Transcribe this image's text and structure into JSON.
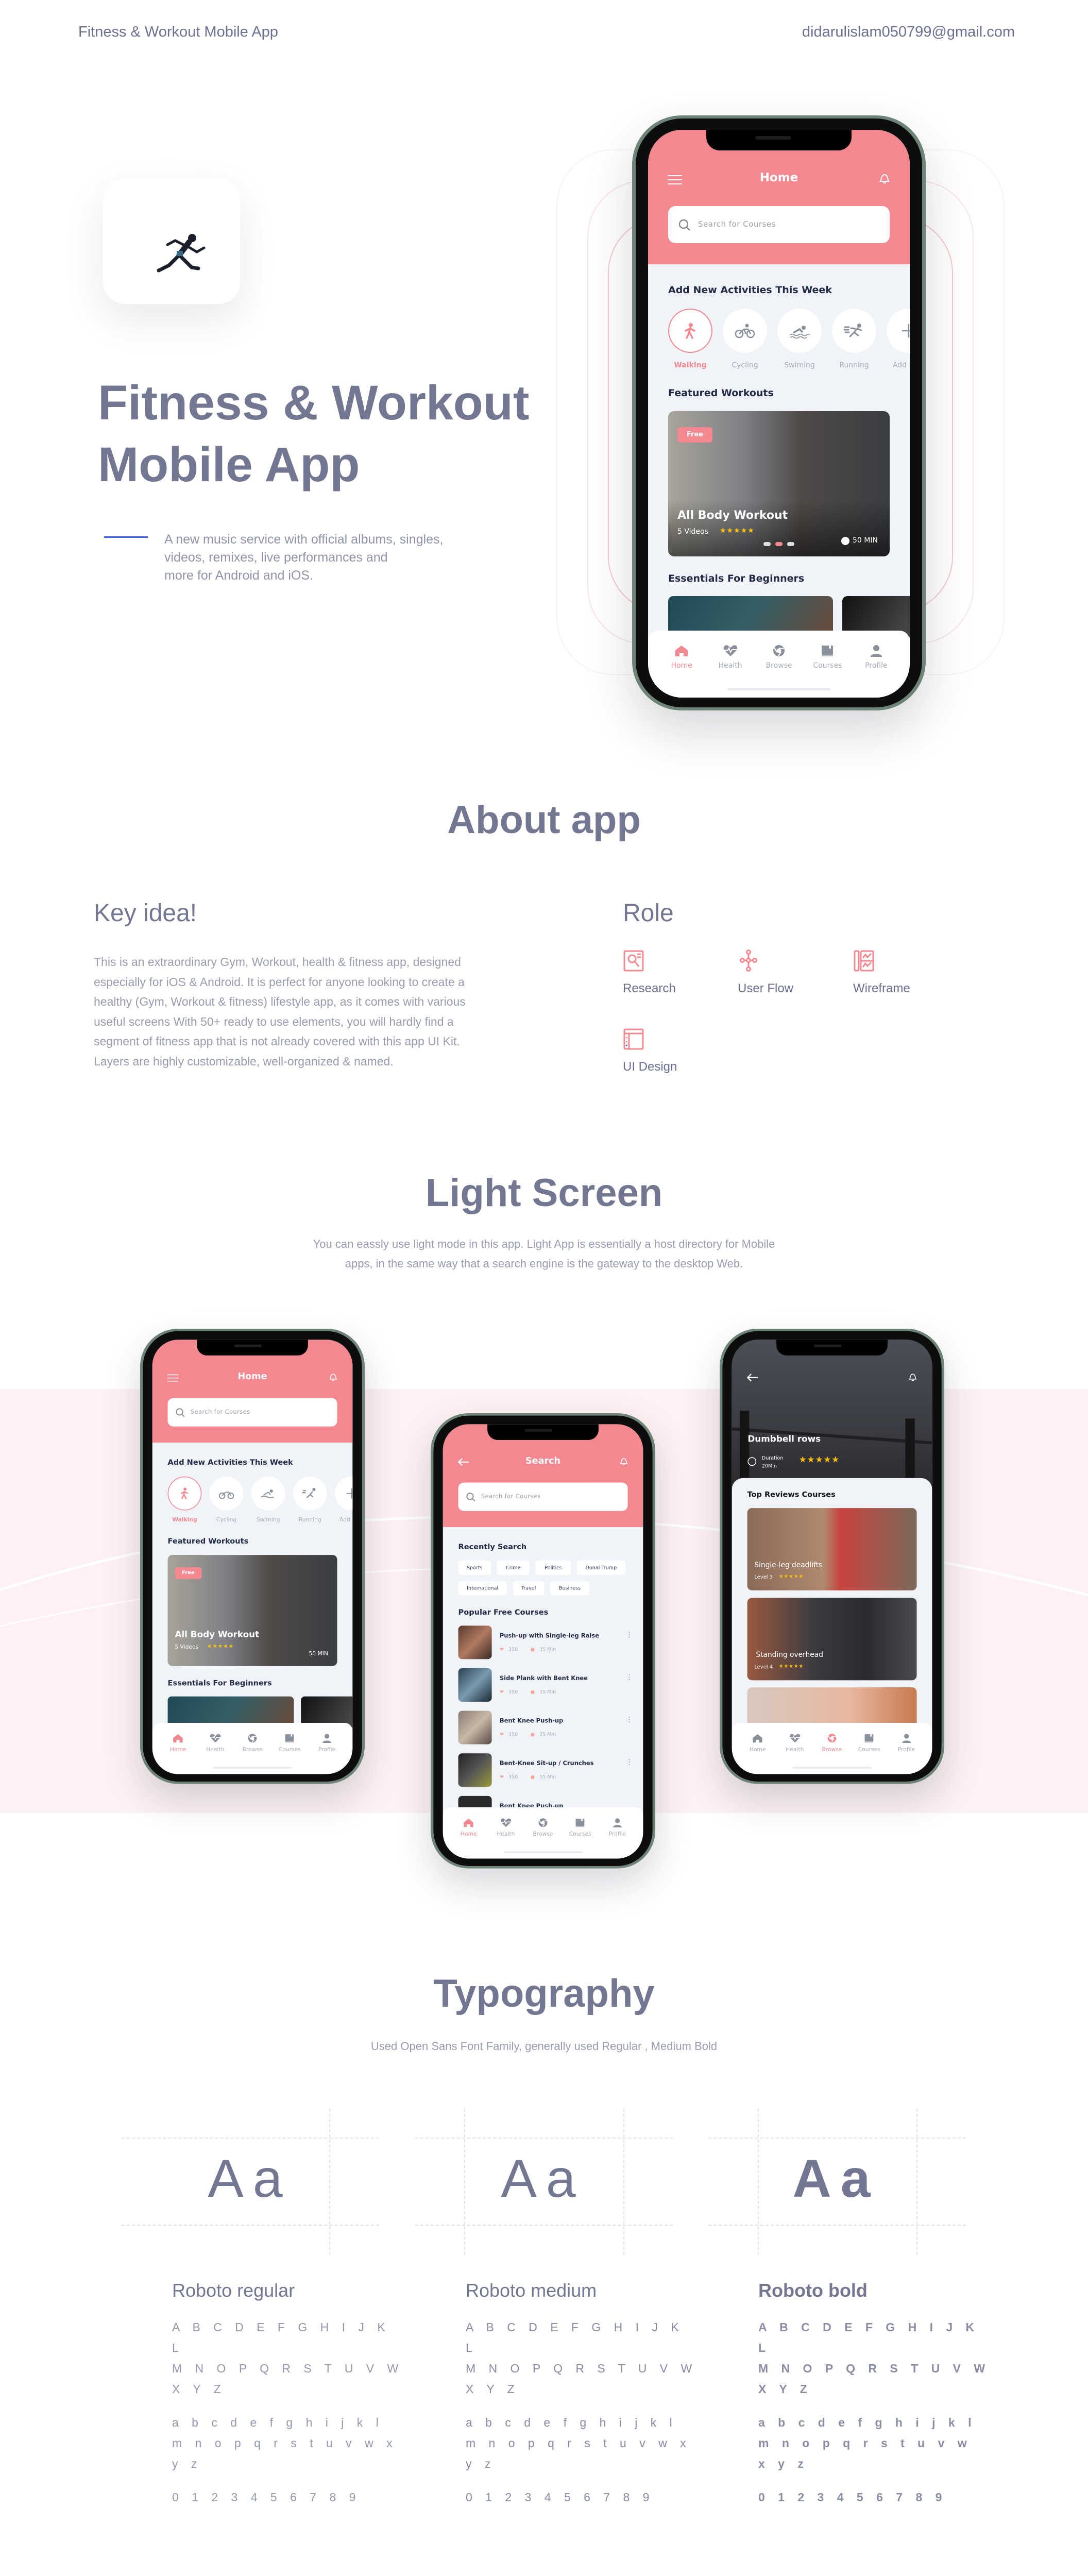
{
  "header": {
    "title": "Fitness & Workout Mobile App",
    "email": "didarulislam050799@gmail.com"
  },
  "hero": {
    "title_lines": [
      "Fitness & Workout",
      "Mobile App"
    ],
    "description_lines": [
      "A new music service with official albums, singles,",
      "videos, remixes, live performances and",
      "more for Android and iOS."
    ]
  },
  "tabbar": [
    "Home",
    "Health",
    "Browse",
    "Courses",
    "Profile"
  ],
  "colors": {
    "accent": "#f48891",
    "title": "#737791",
    "screen_bg": "#f0f3f8",
    "band": "#fdf1f3",
    "star": "#ffc107",
    "underline": "#3a5df0"
  },
  "home_screen": {
    "title": "Home",
    "search_placeholder": "Search for Courses",
    "activities_title": "Add New Activities This Week",
    "activities": [
      {
        "label": "Walking",
        "icon": "walking-icon",
        "active": true
      },
      {
        "label": "Cycling",
        "icon": "cycling-icon"
      },
      {
        "label": "Swiming",
        "icon": "swimming-icon"
      },
      {
        "label": "Running",
        "icon": "running-icon"
      },
      {
        "label": "Add New",
        "icon": "plus-icon"
      }
    ],
    "featured_title": "Featured Workouts",
    "featured": {
      "badge": "Free",
      "title": "All Body Workout",
      "videos": "5 Videos",
      "rating": 5,
      "duration": "50 MIN",
      "stars": "★★★★★"
    },
    "essentials_title": "Essentials For Beginners",
    "active_tab": "Home"
  },
  "search_screen": {
    "title": "Search",
    "search_placeholder": "Search for Courses",
    "recent_title": "Recently Search",
    "chips": [
      "Sports",
      "Crime",
      "Politics",
      "Donal Trump",
      "International",
      "Travel",
      "Business"
    ],
    "popular_title": "Popular Free Courses",
    "courses": [
      {
        "name": "Push-up with Single-leg Raise",
        "likes": "350",
        "duration": "35 Min"
      },
      {
        "name": "Side Plank with Bent Knee",
        "likes": "350",
        "duration": "35 Min"
      },
      {
        "name": "Bent Knee Push-up",
        "likes": "350",
        "duration": "35 Min"
      },
      {
        "name": "Bent-Knee Sit-up / Crunches",
        "likes": "350",
        "duration": "35 Min"
      },
      {
        "name": "Bent Knee Push-up",
        "likes": "",
        "duration": ""
      }
    ],
    "active_tab": "Home"
  },
  "detail_screen": {
    "title": "Dumbbell rows",
    "duration_label": "Duration",
    "duration_value": "20Min",
    "rating": 5,
    "stars": "★★★★★",
    "section_title": "Top Reviews Courses",
    "cards": [
      {
        "title": "Single-leg deadlifts",
        "level": "Level 3",
        "rating": 5
      },
      {
        "title": "Standing overhead",
        "level": "Level 4",
        "rating": 5
      }
    ],
    "active_tab": "Browse"
  },
  "about": {
    "title": "About app",
    "key_idea_title": "Key idea!",
    "key_idea_lines": [
      "This is an extraordinary Gym, Workout, health & fitness app, designed",
      "especially for iOS & Android. It is perfect for anyone looking to create a",
      "healthy (Gym, Workout & fitness) lifestyle app, as it comes with various",
      "useful screens With 50+ ready to use elements, you will hardly find a",
      "segment of fitness app that is not already covered with this app UI Kit.",
      "Layers are highly customizable, well-organized & named."
    ],
    "role_title": "Role",
    "roles": [
      {
        "label": "Research",
        "icon": "research-icon"
      },
      {
        "label": "User Flow",
        "icon": "user-flow-icon"
      },
      {
        "label": "Wireframe",
        "icon": "wireframe-icon"
      },
      {
        "label": "UI Design",
        "icon": "ui-design-icon"
      }
    ]
  },
  "light_screen": {
    "title": "Light Screen",
    "subtitle_lines": [
      "You can eassly use light mode in this app. Light App is essentially a host directory for Mobile",
      "apps, in the same way that a search engine is the gateway to the desktop Web."
    ]
  },
  "typography": {
    "title": "Typography",
    "subtitle": "Used Open Sans Font Family, generally used Regular , Medium Bold",
    "sample": "Aa",
    "fonts": [
      {
        "name": "Roboto regular",
        "upper": [
          "A B C D E F G H I J K L",
          "M N O P Q R S T U V W",
          "X Y Z"
        ],
        "lower": [
          "a b c d e f g h i j k l",
          "m n o p q r s t u v w x",
          "y z"
        ],
        "digits": "0 1 2 3 4 5 6 7 8 9"
      },
      {
        "name": "Roboto medium",
        "upper": [
          "A B C D E F G H I J K L",
          "M N O P Q R S T U V W",
          "X Y Z"
        ],
        "lower": [
          "a b c d e f g h i j k l",
          "m n o p q r s t u v w x",
          "y z"
        ],
        "digits": "0 1 2 3 4 5 6 7 8 9"
      },
      {
        "name": "Roboto bold",
        "upper": [
          "A B C D E F G H I J K L",
          "M N O P Q R S T U V W",
          "X Y Z"
        ],
        "lower": [
          "a b c d e f g h i j k l",
          "m n o p q r s t u v w",
          "x y z"
        ],
        "digits": "0 1 2 3 4 5 6 7 8 9"
      }
    ]
  }
}
